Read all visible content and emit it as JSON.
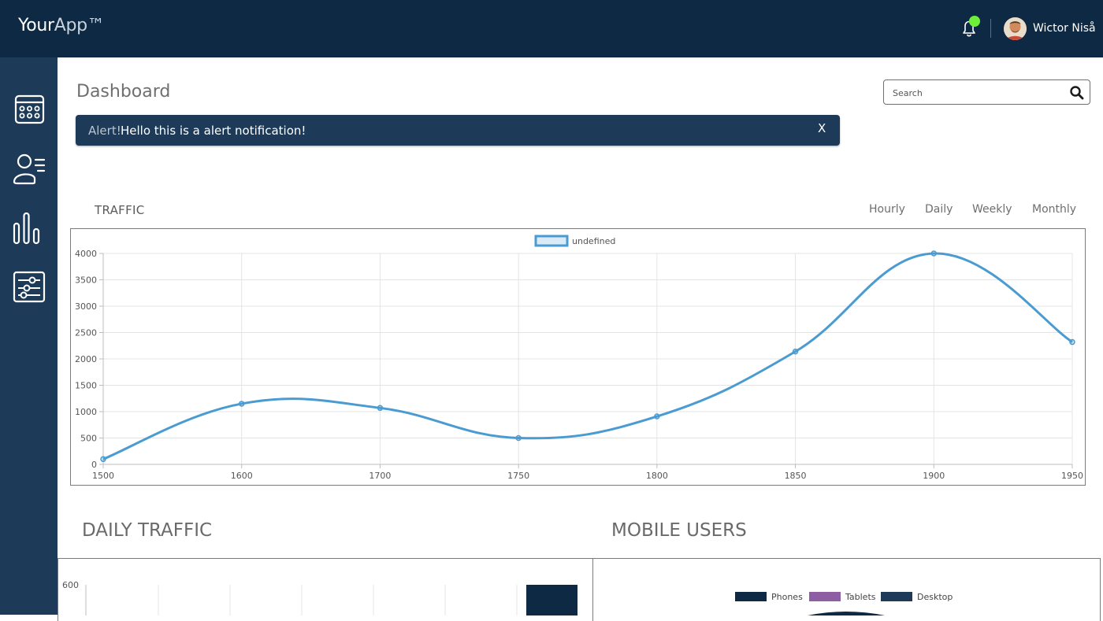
{
  "header": {
    "logo_main": "Your",
    "logo_app": "App™",
    "username": "Wictor Niså",
    "icons": [
      "bell-icon",
      "avatar"
    ]
  },
  "sidebar": {
    "items": [
      {
        "icon": "calendar-icon"
      },
      {
        "icon": "users-list-icon"
      },
      {
        "icon": "bar-chart-icon"
      },
      {
        "icon": "settings-sliders-icon"
      }
    ]
  },
  "page": {
    "title": "Dashboard",
    "search_placeholder": "Search"
  },
  "alert": {
    "strong": "Alert!",
    "message": "Hello this is a alert notification!",
    "close_label": "X"
  },
  "traffic": {
    "title": "TRAFFIC",
    "tabs": [
      "Hourly",
      "Daily",
      "Weekly",
      "Monthly"
    ]
  },
  "sections": {
    "daily_title": "DAILY TRAFFIC",
    "mobile_title": "MOBILE USERS"
  },
  "colors": {
    "header_bg": "#0e2944",
    "sidebar_bg": "#1d3a59",
    "line": "#4a9bd1",
    "notification_dot": "#6ef03a"
  },
  "chart_data": [
    {
      "type": "line",
      "legend": [
        "undefined"
      ],
      "categories": [
        "1500",
        "1600",
        "1700",
        "1750",
        "1800",
        "1850",
        "1900",
        "1950"
      ],
      "series": [
        {
          "name": "undefined",
          "values": [
            100,
            1150,
            1070,
            500,
            910,
            2140,
            4000,
            2320
          ]
        }
      ],
      "yticks": [
        "0",
        "500",
        "1000",
        "1500",
        "2000",
        "2500",
        "3000",
        "3500",
        "4000"
      ],
      "ylim": [
        0,
        4000
      ],
      "grid": true,
      "legend_position": "top"
    },
    {
      "type": "bar",
      "yticks_visible": [
        "600"
      ],
      "partial": true
    },
    {
      "type": "pie",
      "legend": [
        "Phones",
        "Tablets",
        "Desktop"
      ],
      "legend_colors": [
        "#0e2944",
        "#8e5ea2",
        "#1d3a59"
      ],
      "partial": true
    }
  ]
}
